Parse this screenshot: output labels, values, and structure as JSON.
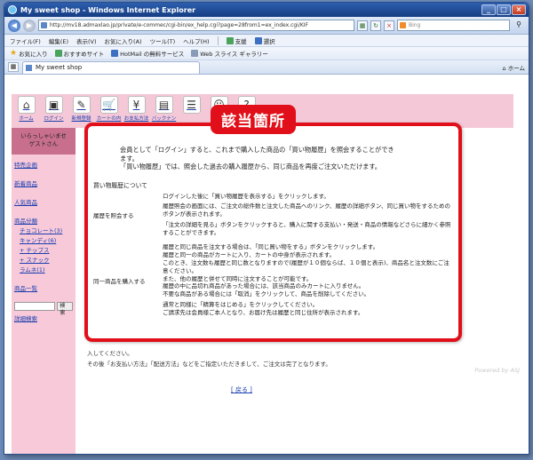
{
  "browser": {
    "title": "My sweet shop - Windows Internet Explorer",
    "url": "http://mv18.admaxlao.jp/private/e-commec/cgi-bin/ex_help.cgi?page=28from1=ex_index.cgi/KIF",
    "search_placeholder": "Bing",
    "menu": [
      "ファイル(F)",
      "編集(E)",
      "表示(V)",
      "お気に入り(A)",
      "ツール(T)",
      "ヘルプ(H)"
    ],
    "menu_tools": [
      "支援",
      "選択"
    ],
    "favorites_label": "お気に入り",
    "favorites": [
      "おすすめサイト",
      "HotMail の無料サービス",
      "Web スライス ギャラリー"
    ],
    "tab_title": "My sweet shop",
    "home_label": "ホーム"
  },
  "nav_icons": [
    {
      "label": "ホーム",
      "icon": "home-icon",
      "glyph": "⌂"
    },
    {
      "label": "ログイン",
      "icon": "login-icon",
      "glyph": "▣"
    },
    {
      "label": "新規登録",
      "icon": "register-icon",
      "glyph": "✎"
    },
    {
      "label": "カートの内容",
      "icon": "cart-icon",
      "glyph": "🛒"
    },
    {
      "label": "お支払方法",
      "icon": "payment-icon",
      "glyph": "¥"
    },
    {
      "label": "バックナンバー",
      "icon": "backnumber-icon",
      "glyph": "▤"
    },
    {
      "label": "",
      "icon": "document-icon",
      "glyph": "☰"
    },
    {
      "label": "",
      "icon": "person-icon",
      "glyph": "☺"
    },
    {
      "label": "",
      "icon": "help-icon",
      "glyph": "?"
    }
  ],
  "sidebar": {
    "welcome_line1": "いらっしゃいませ",
    "welcome_line2": "ゲストさん",
    "links": [
      "特売企画",
      "新着商品",
      "人気商品",
      "商品分類"
    ],
    "categories": [
      "チョコレート(3)",
      "キャンディ(6)",
      "+ チップス",
      "+ スナック",
      "ラムネ(1)"
    ],
    "list_link": "商品一覧",
    "search_button": "検索",
    "detail_search": "詳細検索"
  },
  "callout": {
    "badge": "該当箇所",
    "intro_lines": [
      "会員として「ログイン」すると、これまで購入した商品の「買い物履歴」を照会することができ",
      "ます。",
      "「買い物履歴」では、照会した過去の購入履歴から、同じ商品を再度ご注文いただけます。"
    ],
    "section_title": "買い物履歴について",
    "rows": [
      {
        "label": "履歴を照会する",
        "paras": [
          "ログインした後に「買い物履歴を表示する」をクリックします。",
          "履歴照会の画面には、ご注文の総件数と注文した商品へのリンク、履歴の詳細ボタン、同じ買い物をするためのボタンが表示されます。",
          "「注文の詳細を見る」ボタンをクリックすると、購入に関する支払い・発送・商品の情報などさらに細かく参照することができます。"
        ]
      },
      {
        "label": "同一商品を購入する",
        "paras": [
          "履歴と同じ商品を注文する場合は、「同じ買い物をする」ボタンをクリックします。",
          "履歴と同一の商品がカートに入り、カートの中身が表示されます。",
          "このとき、注文数も履歴と同じ数となりますので(履歴が１０個ならば、１０個と表示)、商品名と注文数にご注意ください。",
          "また、他の履歴と併せて同時に注文することが可能です。",
          "履歴の中に品切れ商品があった場合には、該当商品のみカートに入りません。",
          "不要な商品がある場合には「取消」をクリックして、商品を削除してください。",
          "通常と同様に「精算をはじめる」をクリックしてください。",
          "ご請求先は会員様ご本人となり、お届け先は履歴と同じ住所が表示されます。"
        ]
      }
    ]
  },
  "behind": {
    "line1": "入してください。",
    "line2": "その後「お支払い方法」「配送方法」などをご指定いただきまして、ご注文は完了となります。",
    "back_link": "[ 戻る ]",
    "powered": "Powered by ASJ"
  }
}
